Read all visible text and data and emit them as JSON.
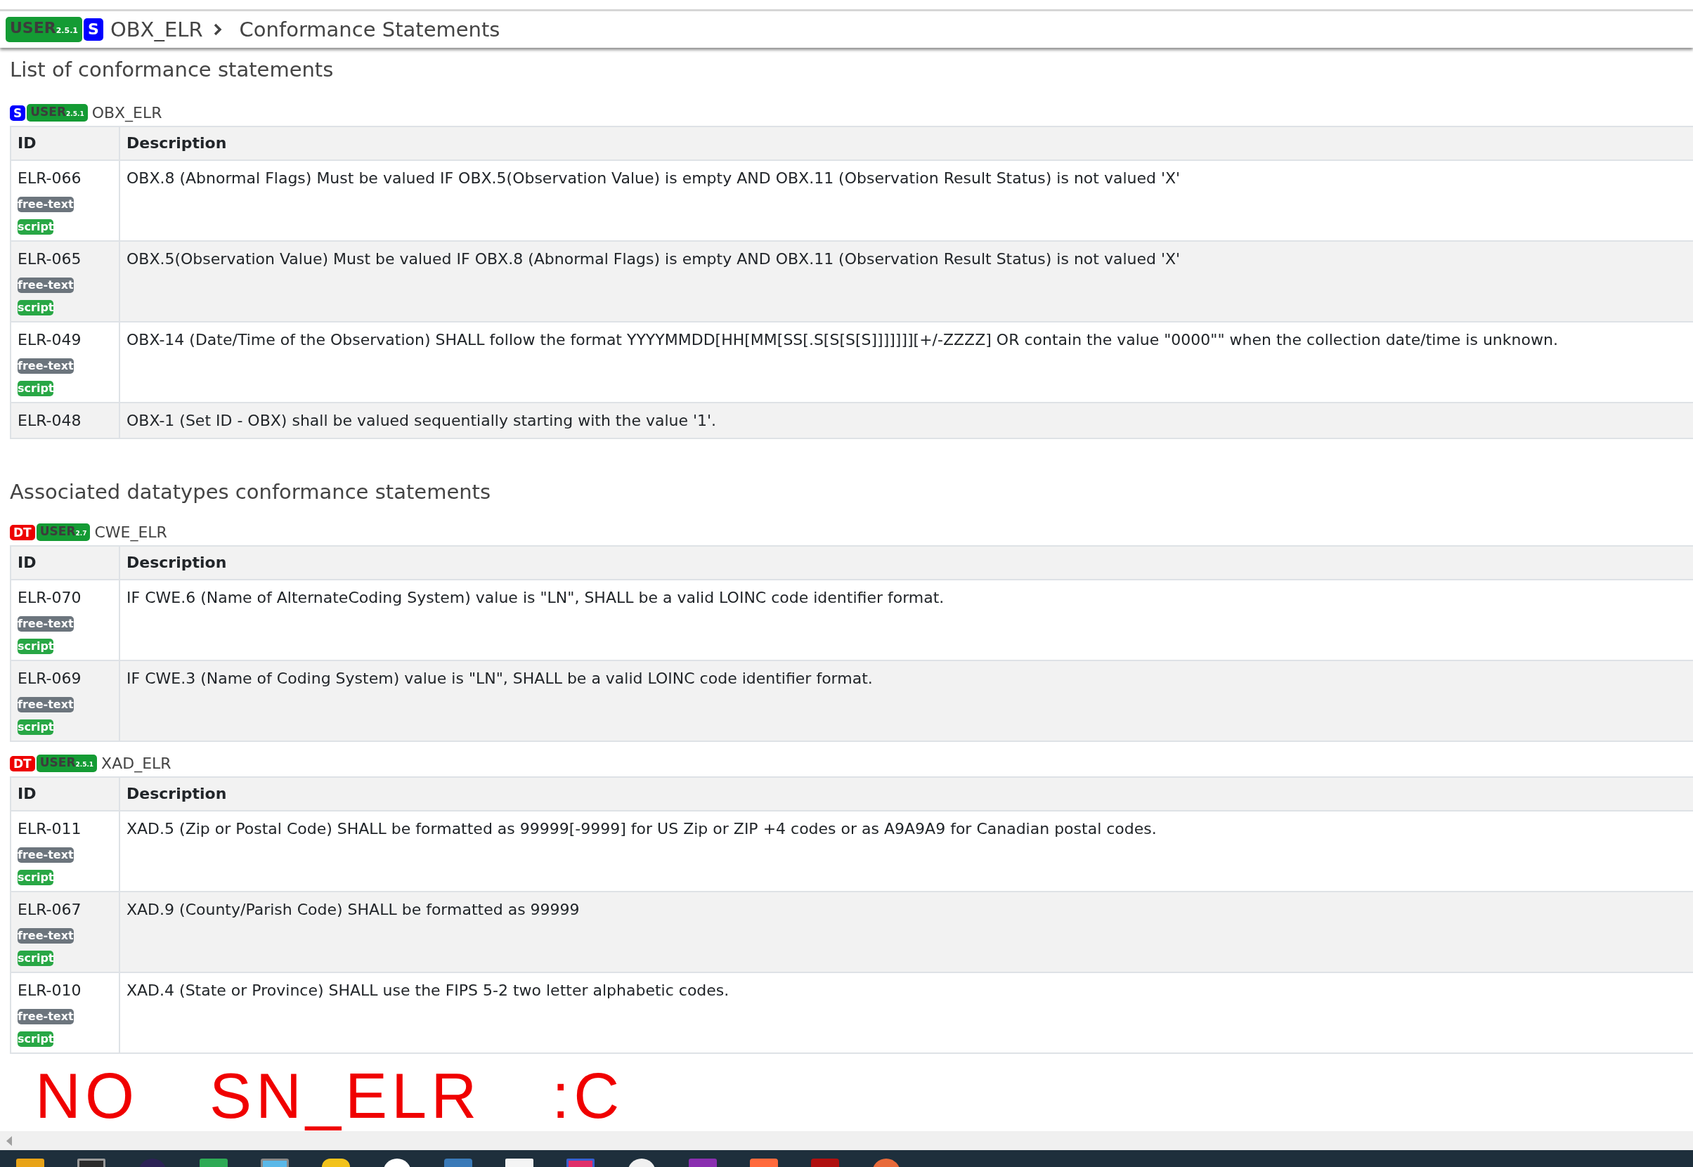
{
  "header": {
    "badges": [
      {
        "kind": "user",
        "label": "USER",
        "version": "2.5.1"
      },
      {
        "kind": "segment",
        "label": "S"
      }
    ],
    "breadcrumb": [
      {
        "label": "OBX_ELR"
      },
      {
        "label": "Conformance Statements"
      }
    ]
  },
  "heading": "List of conformance statements",
  "groups": [
    {
      "badges": [
        {
          "kind": "segment",
          "label": "S"
        },
        {
          "kind": "user",
          "label": "USER",
          "version": "2.5.1"
        }
      ],
      "name": "OBX_ELR",
      "columns": [
        "ID",
        "Description"
      ],
      "rows": [
        {
          "id": "ELR-066",
          "tags": [
            {
              "kind": "free-text",
              "label": "free-text"
            },
            {
              "kind": "script",
              "label": "script"
            }
          ],
          "description": "OBX.8 (Abnormal Flags) Must be valued IF OBX.5(Observation Value) is empty AND OBX.11 (Observation Result Status) is not valued 'X'"
        },
        {
          "id": "ELR-065",
          "tags": [
            {
              "kind": "free-text",
              "label": "free-text"
            },
            {
              "kind": "script",
              "label": "script"
            }
          ],
          "description": "OBX.5(Observation Value) Must be valued IF OBX.8 (Abnormal Flags) is empty AND OBX.11 (Observation Result Status) is not valued 'X'"
        },
        {
          "id": "ELR-049",
          "tags": [
            {
              "kind": "free-text",
              "label": "free-text"
            },
            {
              "kind": "script",
              "label": "script"
            }
          ],
          "description": "OBX-14 (Date/Time of the Observation) SHALL follow the format YYYYMMDD[HH[MM[SS[.S[S[S[S]]]]]]][+/-ZZZZ] OR contain the value \"0000\"\" when the collection date/time is unknown."
        },
        {
          "id": "ELR-048",
          "tags": [],
          "description": "OBX-1 (Set ID - OBX) shall be valued sequentially starting with the value '1'."
        }
      ]
    }
  ],
  "associated_heading": "Associated datatypes conformance statements",
  "datatype_groups": [
    {
      "badges": [
        {
          "kind": "datatype",
          "label": "DT"
        },
        {
          "kind": "user",
          "label": "USER",
          "version": "2.7"
        }
      ],
      "name": "CWE_ELR",
      "columns": [
        "ID",
        "Description"
      ],
      "rows": [
        {
          "id": "ELR-070",
          "tags": [
            {
              "kind": "free-text",
              "label": "free-text"
            },
            {
              "kind": "script",
              "label": "script"
            }
          ],
          "description": "IF CWE.6 (Name of AlternateCoding System) value is \"LN\", SHALL be a valid LOINC code identifier format."
        },
        {
          "id": "ELR-069",
          "tags": [
            {
              "kind": "free-text",
              "label": "free-text"
            },
            {
              "kind": "script",
              "label": "script"
            }
          ],
          "description": "IF CWE.3 (Name of Coding System) value is \"LN\", SHALL be a valid LOINC code identifier format."
        }
      ]
    },
    {
      "badges": [
        {
          "kind": "datatype",
          "label": "DT"
        },
        {
          "kind": "user",
          "label": "USER",
          "version": "2.5.1"
        }
      ],
      "name": "XAD_ELR",
      "columns": [
        "ID",
        "Description"
      ],
      "rows": [
        {
          "id": "ELR-011",
          "tags": [
            {
              "kind": "free-text",
              "label": "free-text"
            },
            {
              "kind": "script",
              "label": "script"
            }
          ],
          "description": "XAD.5 (Zip or Postal Code) SHALL be formatted as 99999[-9999] for US Zip or ZIP +4 codes or as A9A9A9 for Canadian postal codes."
        },
        {
          "id": "ELR-067",
          "tags": [
            {
              "kind": "free-text",
              "label": "free-text"
            },
            {
              "kind": "script",
              "label": "script"
            }
          ],
          "description": "XAD.9 (County/Parish Code) SHALL be formatted as 99999"
        },
        {
          "id": "ELR-010",
          "tags": [
            {
              "kind": "free-text",
              "label": "free-text"
            },
            {
              "kind": "script",
              "label": "script"
            }
          ],
          "description": "XAD.4 (State or Province) SHALL use the FIPS 5-2 two letter alphabetic codes."
        }
      ]
    }
  ],
  "annotation": "NO SN_ELR :C"
}
